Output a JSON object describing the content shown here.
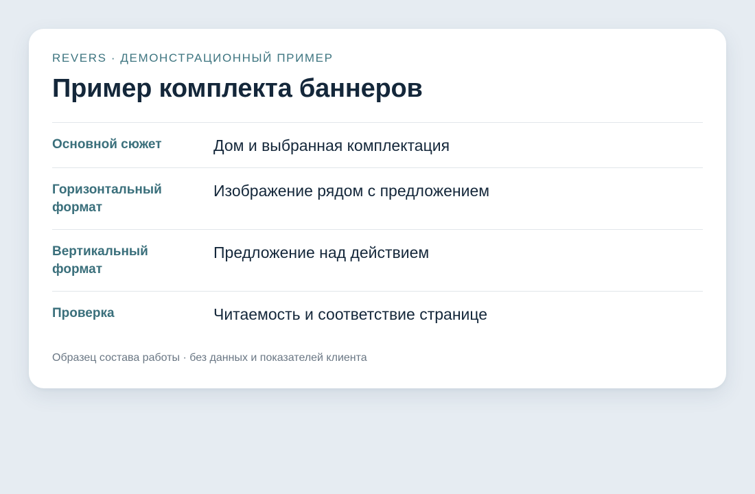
{
  "card": {
    "eyebrow": "REVERS · ДЕМОНСТРАЦИОННЫЙ ПРИМЕР",
    "title": "Пример комплекта баннеров",
    "rows": [
      {
        "label": "Основной сюжет",
        "value": "Дом и выбранная комплектация"
      },
      {
        "label": "Горизонтальный формат",
        "value": "Изображение рядом с предложением"
      },
      {
        "label": "Вертикальный формат",
        "value": "Предложение над действием"
      },
      {
        "label": "Проверка",
        "value": "Читаемость и соответствие странице"
      }
    ],
    "footnote": "Образец состава работы · без данных и показателей клиента"
  },
  "colors": {
    "background": "#e6ecf2",
    "card": "#ffffff",
    "title": "#14273a",
    "label": "#3a6f7b",
    "eyebrow": "#3e7580",
    "muted": "#6a7784",
    "divider": "#e1e6ea"
  }
}
